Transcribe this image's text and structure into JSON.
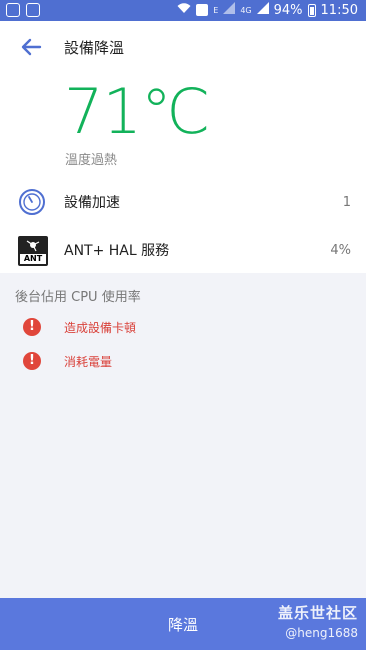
{
  "status_bar": {
    "battery": "94%",
    "time": "11:50",
    "network": "4G",
    "small_text": "E"
  },
  "header": {
    "title": "設備降溫"
  },
  "temperature": {
    "value": "71℃",
    "status": "溫度過熱"
  },
  "items": [
    {
      "label": "設備加速",
      "value": "1",
      "icon": "speedometer-icon"
    },
    {
      "label": "ANT+ HAL 服務",
      "value": "4%",
      "icon": "ant-app-icon",
      "icon_text": "ANT"
    }
  ],
  "background": {
    "title": "後台佔用 CPU 使用率",
    "issues": [
      {
        "label": "造成設備卡頓",
        "icon": "error-icon"
      },
      {
        "label": "消耗電量",
        "icon": "error-icon"
      }
    ]
  },
  "action": {
    "button_label": "降溫"
  },
  "watermark": {
    "line1": "盖乐世社区",
    "line2": "@heng1688"
  },
  "colors": {
    "status_bar": "#4f6fd1",
    "temperature": "#12b25a",
    "error": "#e0463b",
    "button": "#5a78dd"
  }
}
